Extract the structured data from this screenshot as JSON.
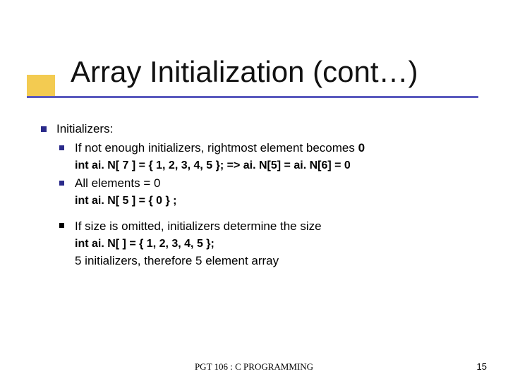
{
  "slide": {
    "title": "Array Initialization (cont…)",
    "top": {
      "label": "Initializers:"
    },
    "bullets": [
      {
        "text_pre": "If not enough initializers, rightmost element becomes ",
        "text_bold": "0",
        "code": "int ai. N[ 7 ] = { 1, 2, 3, 4, 5 }; => ai. N[5] = ai. N[6] = 0"
      },
      {
        "text": "All elements = 0",
        "code": "int ai. N[ 5 ] = { 0 } ;"
      },
      {
        "text": "If size is omitted, initializers determine the size",
        "code": "int ai. N[ ] = { 1, 2, 3, 4, 5 };",
        "after": "5 initializers, therefore 5 element array"
      }
    ],
    "footer": {
      "course": "PGT 106 : C PROGRAMMING",
      "page": "15"
    }
  }
}
